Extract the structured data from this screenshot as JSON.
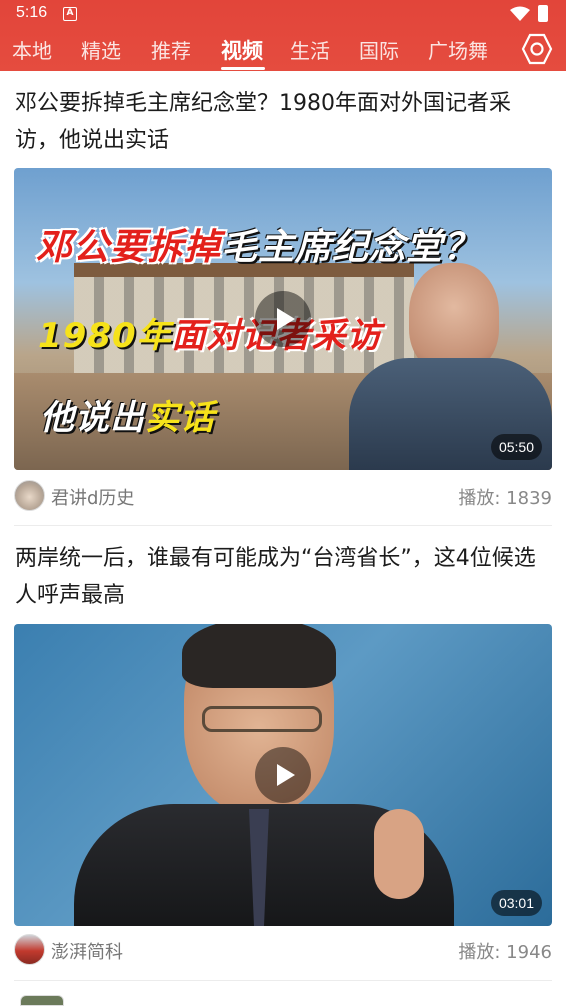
{
  "status_bar": {
    "time": "5:16",
    "app_badge": "A"
  },
  "tabs": [
    {
      "label": "本地",
      "active": false
    },
    {
      "label": "精选",
      "active": false
    },
    {
      "label": "推荐",
      "active": false
    },
    {
      "label": "视频",
      "active": true
    },
    {
      "label": "生活",
      "active": false
    },
    {
      "label": "国际",
      "active": false
    },
    {
      "label": "广场舞",
      "active": false
    }
  ],
  "colors": {
    "header": "#e2453a",
    "title_overlay_red": "#e3201b",
    "title_overlay_yellow": "#f6e21a"
  },
  "articles": [
    {
      "title": "邓公要拆掉毛主席纪念堂？1980年面对外国记者采访，他说出实话",
      "thumb_overlay": {
        "line1_red": "邓公要拆掉",
        "line1_white": "毛主席纪念堂？",
        "line2_yellow": "1980年",
        "line2_red": "面对记者采访",
        "line3_white": "他说出",
        "line3_yellow": "实话"
      },
      "duration": "05:50",
      "author": "君讲d历史",
      "plays": "播放: 1839"
    },
    {
      "title": "两岸统一后，谁最有可能成为“台湾省长”，这4位候选人呼声最高",
      "duration": "03:01",
      "author": "澎湃简科",
      "plays": "播放: 1946"
    }
  ]
}
